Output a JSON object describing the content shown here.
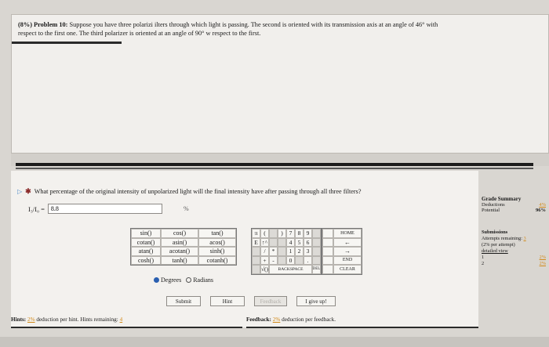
{
  "problem": {
    "heading": "(8%) Problem 10:",
    "text_line1": "Suppose you have three polarizi     ilters through which light is passing. The second is oriented with its transmission axis at an angle of 46° with",
    "text_line2": "respect to the first one. The third polarizer is oriented at an angle of 90° w      respect to the first."
  },
  "question": {
    "text": "What percentage of the original intensity of unpolarized light will the final intensity have after passing through all three filters?"
  },
  "answer": {
    "label": "I₃/I₀ =",
    "value": "8.8",
    "unit": "%"
  },
  "calculator": {
    "functions": [
      [
        "sin()",
        "cos()",
        "tan()"
      ],
      [
        "cotan()",
        "asin()",
        "acos()"
      ],
      [
        "atan()",
        "acotan()",
        "sinh()"
      ],
      [
        "cosh()",
        "tanh()",
        "cotanh()"
      ]
    ],
    "degrees_label": "Degrees",
    "radians_label": "Radians",
    "keys": [
      [
        "π",
        "(",
        "",
        "7",
        "8",
        "9"
      ],
      [
        "E",
        "↑^",
        "",
        "4",
        "5",
        "6"
      ],
      [
        "",
        "/",
        "*",
        "1",
        "2",
        "3"
      ],
      [
        "",
        "+",
        "-",
        "0",
        "",
        ""
      ],
      [
        "",
        "√()",
        "",
        "",
        "",
        ""
      ]
    ],
    "home": "HOME",
    "left": "←",
    "right": "→",
    "end": "END",
    "backspace": "BACKSPACE",
    "del": "DEL",
    "clear": "CLEAR"
  },
  "buttons": {
    "submit": "Submit",
    "hint": "Hint",
    "feedback": "Feedback",
    "give_up": "I give up!"
  },
  "hints": {
    "label": "Hints:",
    "pct": "2%",
    "text": "deduction per hint. Hints remaining:",
    "remaining": "4"
  },
  "feedback": {
    "label": "Feedback:",
    "pct": "2%",
    "text": "deduction per feedback."
  },
  "grade_summary": {
    "title": "Grade Summary",
    "deductions_label": "Deductions",
    "deductions_value": "4%",
    "potential_label": "Potential",
    "potential_value": "96%"
  },
  "submissions": {
    "title": "Submissions",
    "attempts_label": "Attempts remaining:",
    "attempts_value": "3",
    "per_attempt": "(2% per attempt)",
    "detailed_view": "detailed view",
    "rows": [
      {
        "n": "1",
        "v": "2%"
      },
      {
        "n": "2",
        "v": "2%"
      }
    ]
  }
}
